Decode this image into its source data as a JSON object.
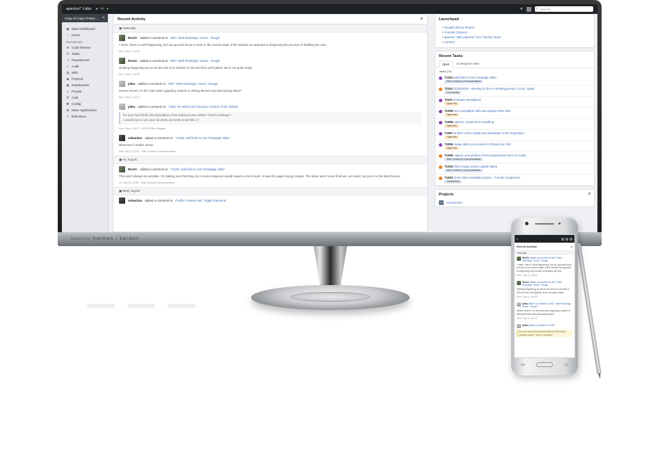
{
  "topbar": {
    "logo": "apertus° Labs",
    "search_placeholder": "Search"
  },
  "sidebar": {
    "current": "Copy of Copy of New ...",
    "items_top": [
      {
        "label": "Main Dashboard",
        "icon": "dashboard-icon"
      },
      {
        "label": "Home",
        "icon": "home-icon"
      }
    ],
    "section_label": "FAVORITES",
    "items": [
      {
        "label": "Code Review",
        "icon": "code-icon"
      },
      {
        "label": "Tasks",
        "icon": "tasks-icon"
      },
      {
        "label": "Repositories",
        "icon": "repo-icon"
      },
      {
        "label": "Audit",
        "icon": "audit-icon"
      },
      {
        "label": "Wiki",
        "icon": "wiki-icon"
      },
      {
        "label": "Projects",
        "icon": "projects-icon"
      },
      {
        "label": "Dashboards",
        "icon": "dashboards-icon"
      },
      {
        "label": "People",
        "icon": "people-icon"
      },
      {
        "label": "Auth",
        "icon": "auth-icon"
      },
      {
        "label": "Config",
        "icon": "config-icon"
      },
      {
        "label": "More Applications",
        "icon": "apps-icon"
      },
      {
        "label": "Edit Menu",
        "icon": "edit-icon"
      }
    ]
  },
  "activity": {
    "title": "Recent Activity",
    "days": {
      "d1": "Yesterday",
      "d2": "Fri, Aug 31",
      "d3": "Wed, Aug 29"
    },
    "items": [
      {
        "user": "RexOr",
        "action": "added a comment to",
        "target": "M57: Web Redesign: Home - Rough",
        "body": "I mean, there is stuff happening, but our general focus is more in the current state of the website as opposed to beginning the process of building the new.",
        "meta": "Mon, Sep 3, 16:26"
      },
      {
        "user": "RexOr",
        "action": "added a comment to",
        "target": "M57: Web Redesign: Home - Rough",
        "body": "Nothing happening as yet as the aim is to rebuild on G8 and then we'll gather we're not quite ready.",
        "meta": "Mon, Sep 3, 16:28"
      },
      {
        "user": "jatha",
        "action": "added a comment to",
        "target": "M57: Web Redesign: Home - Rough",
        "body": "seems recent 1 in the main task regarding content or writing themes and discussing ideas?",
        "meta": "Mon, Sep 3, 16:31"
      },
      {
        "user": "jatha",
        "action": "added a comment to",
        "target": "T253: Re-write level low price version of the Robots",
        "quote_1": "Do your have links documentation of the build process online? Tool in Herbage?",
        "quote_2": "I would love to see your 3d prints and early ensemble (-)",
        "meta": "Mon, Sep 3, 16:27 · WHOM Bilbo Baggins"
      },
      {
        "user": "sebastian",
        "action": "added a comment to",
        "target": "T1103: add links to cam frontpage slider",
        "body": "whenever it makes sense",
        "meta": "Mon, Sep 3, 11:00 · With Content & Documentation"
      },
      {
        "user": "RexOr",
        "action": "added a comment to",
        "target": "T1103: add links to cam frontpage slider",
        "body": "This won't always be possible. Or making sure that they do in some instances would require a bit of work, in specific pages being created. The slider aren't more final are, as noted, but put it on the back burner.",
        "meta": "Fri, Aug 31, 09:46 · With Content & Documentation"
      },
      {
        "user": "sebastian",
        "action": "added a comment to",
        "target": "Profile Content Unit: Toggle Elements"
      }
    ]
  },
  "launchpad": {
    "title": "Launchpad",
    "links": [
      "Google (Docs) Shares",
      "Youtube (Videos)",
      "apertus° Wiki (apertus° Dev Tracks) Team",
      "Contact"
    ]
  },
  "tasks": {
    "title": "Recent Tasks",
    "tab_open": "Open",
    "tab_unassigned": "Unassigned tasks",
    "count_label": "Tasks (10)",
    "items": [
      {
        "id": "T1103",
        "title": "add links to cam frontpage slider",
        "tag": "Web Content & Documentation",
        "tag_color": "#dbe6f6",
        "pri_color": "#8e44ad"
      },
      {
        "id": "T1102",
        "title": "21/08/2018 - Meeting to form a working group in Lusin, Spain",
        "tag": "Community",
        "tag_color": "#e1e6ec",
        "pri_color": "#e67e22"
      },
      {
        "id": "T1101",
        "title": "Evaluate NextSpeed",
        "tag": "Open Hw",
        "tag_color": "#fde8c8",
        "pri_color": "#8e44ad"
      },
      {
        "id": "T1099",
        "title": "Not Compatible with raw apertus DNG files",
        "tag": "Open Hw",
        "tag_color": "#fde8c8",
        "pri_color": "#8e44ad"
      },
      {
        "id": "T1098",
        "title": "OpenCL needs Error Handling",
        "tag": "Open Hw",
        "tag_color": "#fde8c8",
        "pri_color": "#8e44ad"
      },
      {
        "id": "T1097",
        "title": "Broken Link in Build Documentation in the Repository",
        "tag": "Open Hw",
        "tag_color": "#fde8c8",
        "pri_color": "#8e44ad"
      },
      {
        "id": "T1096",
        "title": "Image data not received in Process by Tool",
        "tag": "Open Hw",
        "tag_color": "#fde8c8",
        "pri_color": "#8e44ad"
      },
      {
        "id": "T1095",
        "title": "capture new photos of new powerboard when its ready",
        "tag": "Web Content & Documentation",
        "tag_color": "#dbe6f6",
        "pri_color": "#e67e22"
      },
      {
        "id": "T1094",
        "title": "three image sensor update blank",
        "tag": "Web Content & Documentation",
        "tag_color": "#dbe6f6",
        "pri_color": "#e67e22"
      },
      {
        "id": "T1093",
        "title": "RAW video metadata tracker - Format comparison",
        "tag": "Toolbar/Dev",
        "tag_color": "#e1e6ec",
        "pri_color": "#e67e22"
      }
    ]
  },
  "projects": {
    "title": "Projects",
    "items": [
      "Accessories"
    ]
  },
  "phone": {
    "title": "Recent Activity",
    "day": "Yesterday",
    "items": [
      {
        "user": "RexOr",
        "action": "added a comment to M57: Web Redesign: Home - Rough",
        "body": "I mean, there is stuff happening, but our general focus is more in the current state of the website as opposed to beginning the process of building the new.",
        "meta": "Mon, Sep 3, 16:26"
      },
      {
        "user": "RexOr",
        "action": "added a comment to M57: Web Redesign: Home - Rough",
        "body": "Nothing happening as yet as the aim is to rebuild on G8 and then we'll gather we're not quite ready.",
        "meta": "Mon, Sep 3, 16:28"
      },
      {
        "user": "jatha",
        "action": "added a comment to M57: Web Redesign: Home - Rough",
        "body": "seems recent 1 in the main task regarding content or writing themes and discussing ideas?",
        "meta": "Mon, Sep 3, 16:31"
      },
      {
        "user": "jatha",
        "action": "added a comment to T253",
        "quote": "Do your have links documentation of the build process online? Tool in Herbage?"
      }
    ]
  },
  "brand": {
    "prefix": "Sound by",
    "name": "harman / kardon"
  },
  "colors": {
    "accent": "#3b6bb5",
    "dark": "#1e2125",
    "sidebar": "#e7e9ec"
  }
}
